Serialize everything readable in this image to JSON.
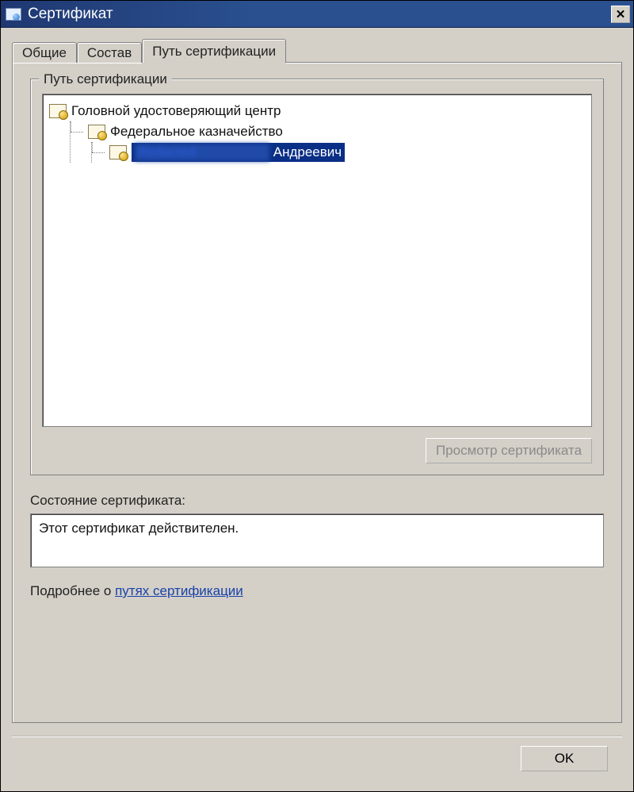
{
  "title": "Сертификат",
  "tabs": {
    "general": "Общие",
    "details": "Состав",
    "path": "Путь сертификации"
  },
  "group": {
    "legend": "Путь сертификации",
    "tree": {
      "root": "Головной удостоверяющий центр",
      "mid": "Федеральное казначейство",
      "leaf_visible": "Андреевич"
    },
    "view_button": "Просмотр сертификата"
  },
  "status": {
    "label": "Состояние сертификата:",
    "value": "Этот сертификат действителен."
  },
  "more": {
    "prefix": "Подробнее о ",
    "link": "путях сертификации"
  },
  "ok": "OK"
}
